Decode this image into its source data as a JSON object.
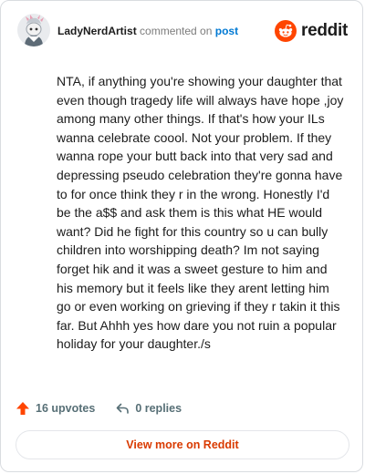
{
  "header": {
    "author": "LadyNerdArtist",
    "action_text": "commented on",
    "post_link": "post",
    "brand": "reddit"
  },
  "comment": {
    "text": "NTA, if anything you're showing your daughter that even though tragedy life will always have hope ,joy among many other things. If that's how your ILs wanna celebrate coool. Not your problem. If they wanna rope your butt back into that very sad and depressing pseudo celebration they're gonna have to for once think they r in the wrong. Honestly I'd be the a$$ and ask them is this what HE would want? Did he fight for this country so u can bully children into worshipping death? Im not saying forget hik and it was a sweet gesture to him and his memory but it feels like they arent letting him go or even working on grieving if they r takin it this far. But Ahhh yes how dare you not ruin a popular holiday for your daughter./s"
  },
  "actions": {
    "upvotes": "16 upvotes",
    "replies": "0 replies"
  },
  "footer": {
    "view_more": "View more on Reddit"
  },
  "icons": {
    "avatar": "snoo-avatar-icon",
    "brand": "reddit-logo-icon",
    "upvote": "upvote-arrow-icon",
    "reply": "reply-arrow-icon"
  },
  "colors": {
    "brand": "#ff4500",
    "link": "#0079d3",
    "view_more": "#d93a00",
    "muted": "#576f76"
  }
}
